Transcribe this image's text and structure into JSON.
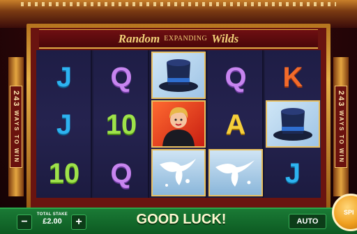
{
  "title": {
    "word1": "Random",
    "word2": "EXPANDING",
    "word3": "Wilds"
  },
  "ways": {
    "number": "243",
    "text": "WAYS TO WIN"
  },
  "reels": [
    [
      "J",
      "J",
      "10"
    ],
    [
      "Q",
      "10",
      "Q"
    ],
    [
      "top-hat",
      "magician-girl",
      "doves"
    ],
    [
      "Q",
      "A",
      "doves"
    ],
    [
      "K",
      "top-hat",
      "J"
    ]
  ],
  "controls": {
    "minus_label": "−",
    "plus_label": "+",
    "stake_label": "TOTAL STAKE",
    "stake_value": "£2.00",
    "message": "GOOD LUCK!",
    "auto_label": "AUTO",
    "spin_label": "SPI"
  },
  "colors": {
    "accent_gold": "#e9c060",
    "panel_green": "#1a7a35"
  }
}
